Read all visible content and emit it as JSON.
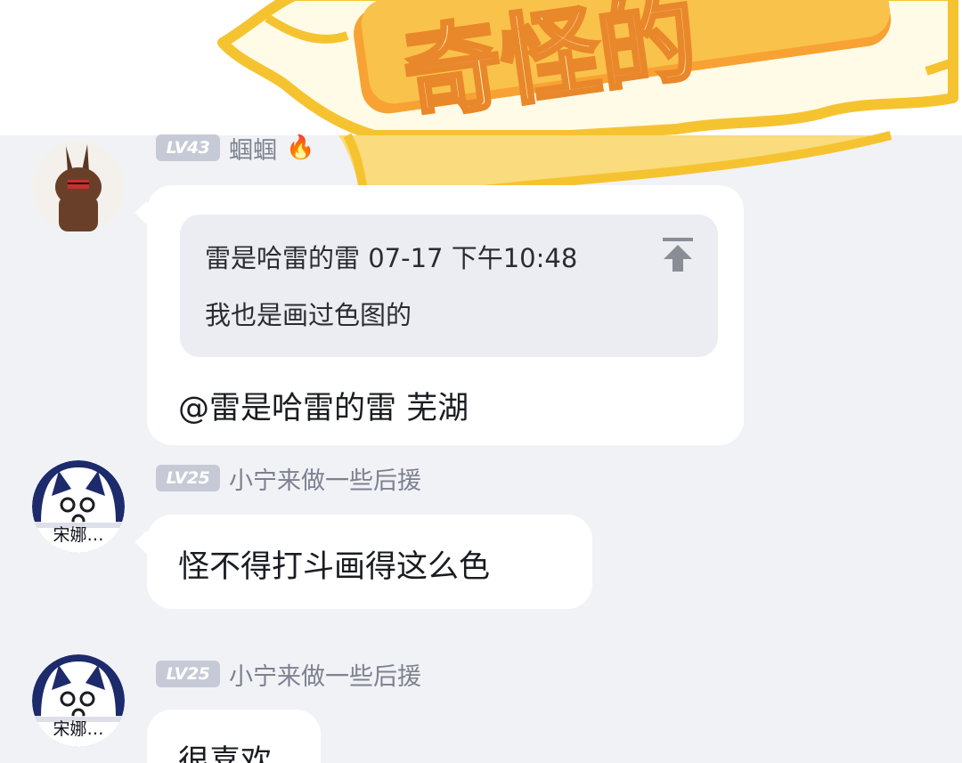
{
  "banner": {
    "title_art": "奇怪的"
  },
  "messages": [
    {
      "level": "LV43",
      "username": "蝈蝈",
      "badge_icon": "fire-icon",
      "quote": {
        "author_time": "雷是哈雷的雷 07-17 下午10:48",
        "text": "我也是画过色图的"
      },
      "text": "@雷是哈雷的雷 芜湖"
    },
    {
      "level": "LV25",
      "username": "小宁来做一些后援",
      "avatar_tag": "宋娜…",
      "text": "怪不得打斗画得这么色"
    },
    {
      "level": "LV25",
      "username": "小宁来做一些后援",
      "avatar_tag": "宋娜…",
      "text": "很喜欢"
    }
  ],
  "colors": {
    "background": "#f1f2f6",
    "bubble": "#ffffff",
    "level_badge": "#c6cad6",
    "accent_yellow": "#f6c330"
  }
}
